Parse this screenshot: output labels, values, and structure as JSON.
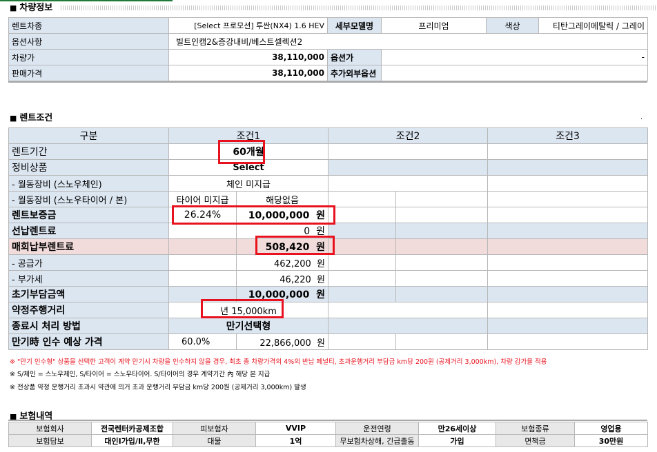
{
  "vehicle": {
    "title": "차량정보",
    "model_label": "렌트차종",
    "model_value": "[Select 프로모션] 투싼(NX4) 1.6 HEV",
    "submodel_label": "세부모델명",
    "submodel_value": "프리미엄",
    "color_label": "색상",
    "color_value": "티탄그레이메탈릭 / 그레이",
    "options_label": "옵션사항",
    "options_value": "빌트인캠2&증강내비/베스트셀렉션2",
    "price_label": "차량가",
    "price_value": "38,110,000",
    "option_price_label": "옵션가",
    "option_price_value": "-",
    "sale_label": "판매가격",
    "sale_value": "38,110,000",
    "extra_label": "추가외부옵션",
    "extra_value": ""
  },
  "rent": {
    "title": "렌트조건",
    "col_category": "구분",
    "col_1": "조건1",
    "col_2": "조건2",
    "col_3": "조건3",
    "period_label": "렌트기간",
    "period_value": "60개월",
    "maint_label": "정비상품",
    "maint_value": "Select",
    "chain_label": "- 월동장비 (스노우체인)",
    "chain_value": "체인 미지급",
    "tire_label": "- 월동장비 (스노우타이어 / 본)",
    "tire_value_a": "타이어 미지급",
    "tire_value_b": "해당없음",
    "deposit_label": "렌트보증금",
    "deposit_pct": "26.24%",
    "deposit_value": "10,000,000",
    "prepay_label": "선납렌트료",
    "prepay_value": "0",
    "monthly_label": "매회납부렌트료",
    "monthly_value": "508,420",
    "supply_label": "- 공급가",
    "supply_value": "462,200",
    "vat_label": "- 부가세",
    "vat_value": "46,220",
    "initial_label": "초기부담금액",
    "initial_value": "10,000,000",
    "mileage_label": "약정주행거리",
    "mileage_value": "년 15,000km",
    "end_label": "종료시 처리 방법",
    "end_value": "만기선택형",
    "residual_label": "만기時 인수 예상 가격",
    "residual_pct": "60.0%",
    "residual_value": "22,866,000",
    "won": "원"
  },
  "notes": {
    "n1": "※ \"만기 인수형\" 상품을 선택한 고객이 계약 만기시 차량을 인수하지 않을 경우, 최초 총 차량가격의 4%의 반납 페널티, 초과운행거리 부담금 km당 200원 (공제거리 3,000km), 차량 감가율 적용",
    "n2": "※ S/체인 = 스노우체인, S/타이어 = 스노우타이어. S/타이어의 경우 계약기간 內 해당 본 지급",
    "n3": "※ 전상품 약정 운행거리 초과시 약관에 의거 초과 운행거리 부담금 km당 200원 (공제거리 3,000km) 발생"
  },
  "insurance": {
    "title": "보험내역",
    "r1": [
      "보험회사",
      "전국렌터카공제조합",
      "피보험자",
      "VVIP",
      "운전연령",
      "만26세이상",
      "보험종류",
      "영업용"
    ],
    "r2": [
      "보험담보",
      "대인Ⅰ가입/Ⅱ,무한",
      "대물",
      "1억",
      "무보험차상해, 긴급출동",
      "가입",
      "면책금",
      "30만원"
    ]
  },
  "colors": {
    "highlight_row": "#f2dcdb",
    "label_bg": "#dce6f1",
    "red_box": "#e8121e"
  }
}
